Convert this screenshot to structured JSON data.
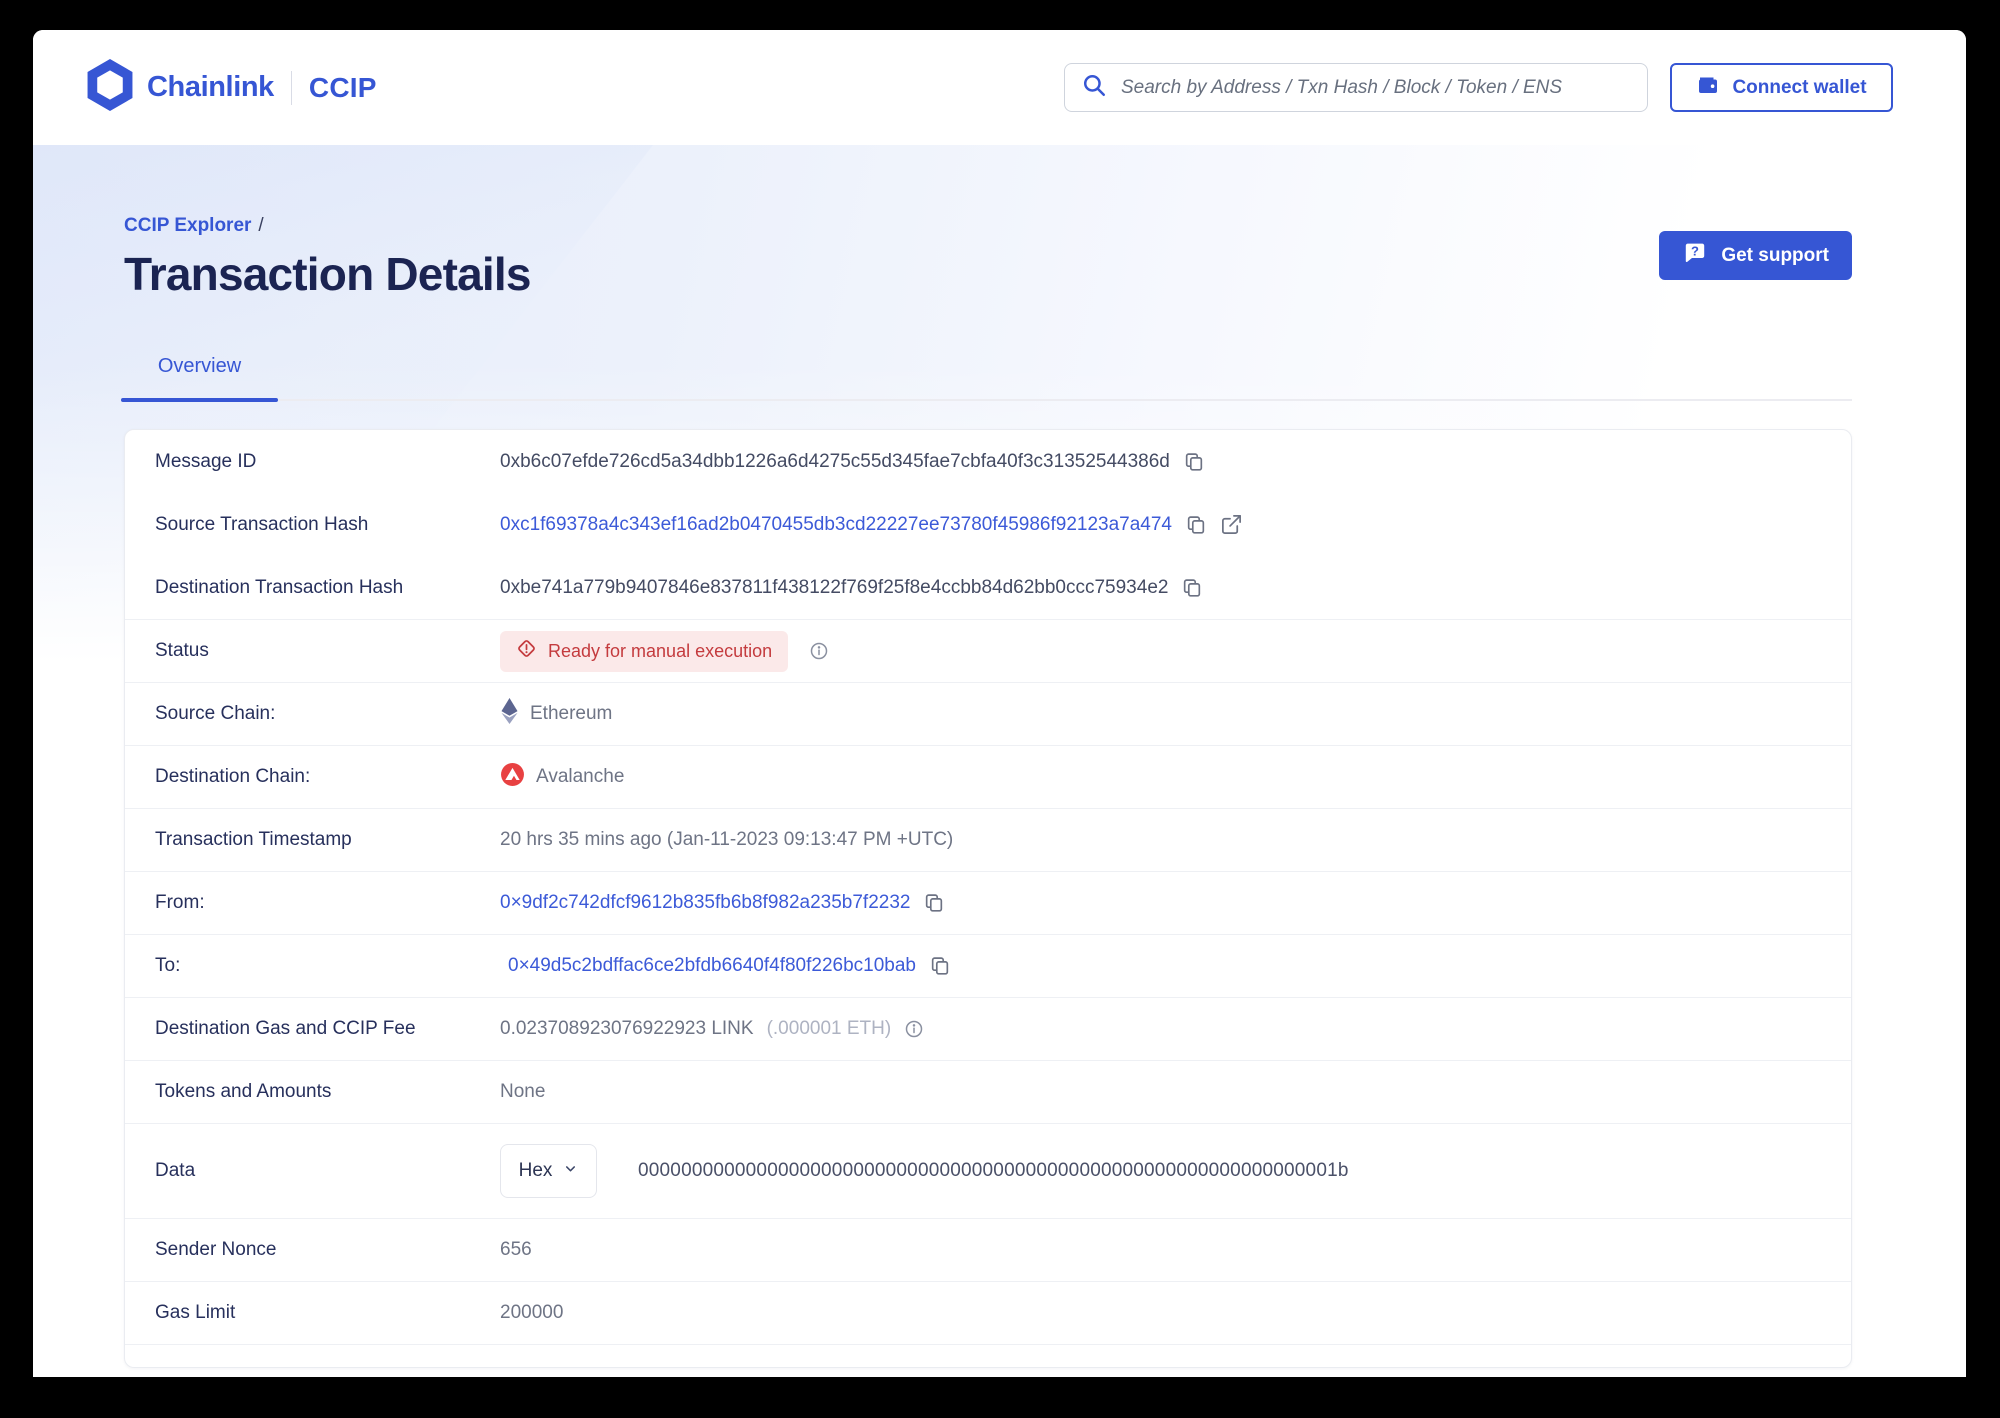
{
  "colors": {
    "brand_blue": "#3656D4",
    "title_navy": "#1B2452",
    "link_blue": "#3C5AD8",
    "status_red": "#C43B3E",
    "status_bg": "#FBE9E9",
    "avalanche_red": "#E84142",
    "ethereum_gray": "#5C6590"
  },
  "header": {
    "brand": "Chainlink",
    "product": "CCIP",
    "search_placeholder": "Search by Address / Txn Hash / Block / Token / ENS",
    "connect_wallet_label": "Connect wallet"
  },
  "page": {
    "breadcrumb": "CCIP Explorer",
    "breadcrumb_separator": "/",
    "title": "Transaction Details",
    "get_support_label": "Get support",
    "tab": "Overview"
  },
  "details": {
    "rows": [
      {
        "label": "Message ID",
        "value": "0xb6c07efde726cd5a34dbb1226a6d4275c55d345fae7cbfa40f3c31352544386d"
      },
      {
        "label": "Source Transaction Hash",
        "value": "0xc1f69378a4c343ef16ad2b0470455db3cd22227ee73780f45986f92123a7a474"
      },
      {
        "label": "Destination Transaction Hash",
        "value": "0xbe741a779b9407846e837811f438122f769f25f8e4ccbb84d62bb0ccc75934e2"
      },
      {
        "label": "Status",
        "value": "Ready for manual execution"
      },
      {
        "label": "Source Chain:",
        "value": "Ethereum"
      },
      {
        "label": "Destination Chain:",
        "value": "Avalanche"
      },
      {
        "label": "Transaction Timestamp",
        "value": "20 hrs 35 mins ago (Jan-11-2023 09:13:47 PM +UTC)"
      },
      {
        "label": "From:",
        "value": "0×9df2c742dfcf9612b835fb6b8f982a235b7f2232"
      },
      {
        "label": "To:",
        "value": "0×49d5c2bdffac6ce2bfdb6640f4f80f226bc10bab"
      },
      {
        "label": "Destination Gas and CCIP Fee",
        "value": "0.023708923076922923 LINK",
        "secondary": "(.000001 ETH)"
      },
      {
        "label": "Tokens and Amounts",
        "value": "None"
      },
      {
        "label": "Data",
        "selector": "Hex",
        "value": "00000000000000000000000000000000000000000000000000000000000000001b"
      },
      {
        "label": "Sender Nonce",
        "value": "656"
      },
      {
        "label": "Gas Limit",
        "value": "200000"
      }
    ]
  }
}
